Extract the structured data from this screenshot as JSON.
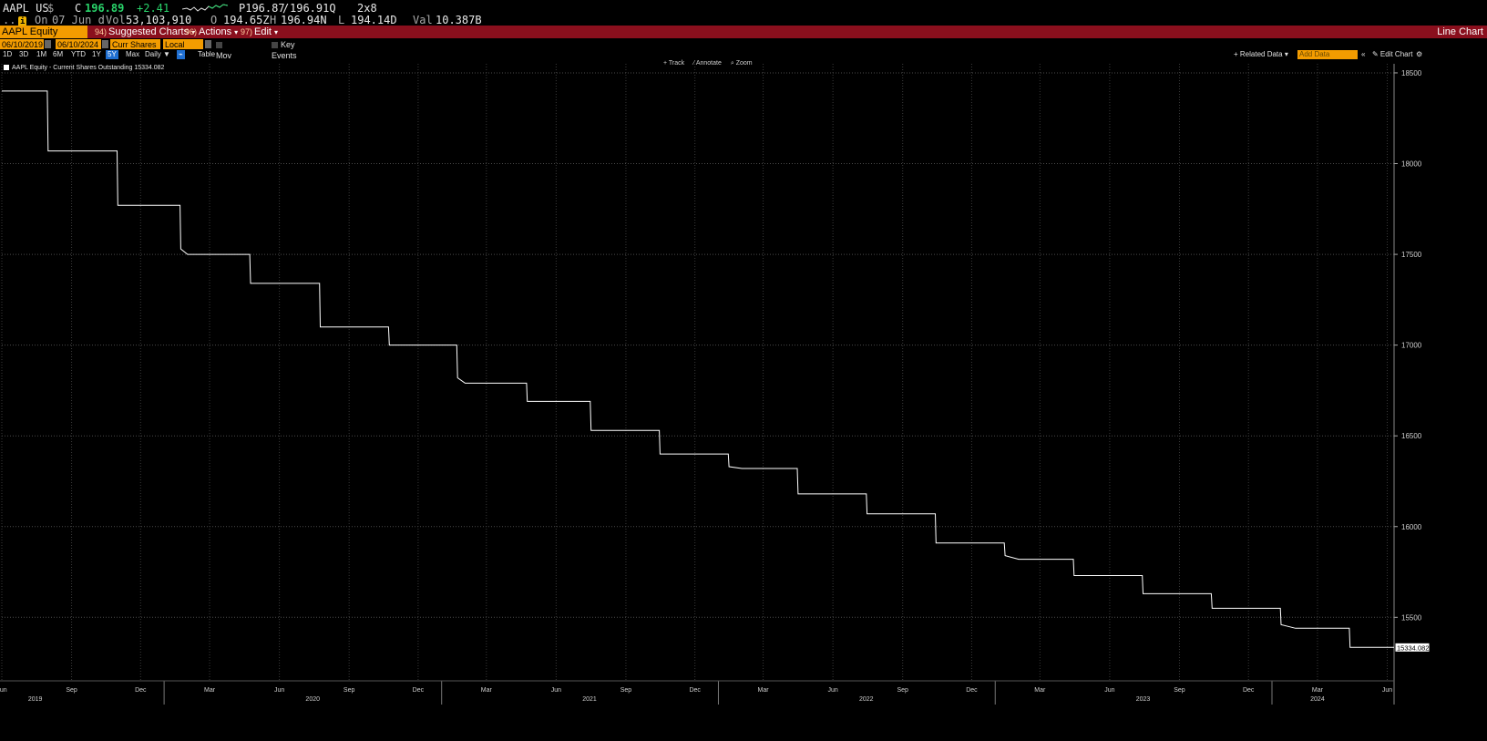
{
  "quote": {
    "ticker": "AAPL US",
    "currency_symbol": "$",
    "close_label": "C",
    "close_value": "196.89",
    "change": "+2.41",
    "pbid": "P196.87",
    "slash": "/",
    "ask": "196.91Q",
    "size": "2x8",
    "icon_label": "On",
    "on_date": "07 Jun d",
    "vol_label": "Vol",
    "vol_value": "53,103,910",
    "open_label": "O",
    "open_value": "194.65Z",
    "high_label": "H",
    "high_value": "196.94N",
    "low_label": "L",
    "low_value": "194.14D",
    "val_label": "Val",
    "val_value": "10.387B"
  },
  "menubar": {
    "security": "AAPL Equity",
    "items": [
      {
        "num": "94)",
        "label": "Suggested Charts"
      },
      {
        "num": "96)",
        "label": "Actions"
      },
      {
        "num": "97)",
        "label": "Edit"
      }
    ],
    "chart_type": "Line Chart"
  },
  "controls": {
    "start_date": "06/10/2019",
    "end_date": "06/10/2024",
    "field": "Curr Shares C",
    "currency": "Local CCY",
    "mov_avgs": "Mov Avgs",
    "key_events": "Key Events"
  },
  "periods": {
    "items": [
      "1D",
      "3D",
      "1M",
      "6M",
      "YTD",
      "1Y",
      "5Y",
      "Max"
    ],
    "active": "5Y",
    "frequency": "Daily ▼",
    "table": "Table",
    "related_data": "+ Related Data ▾",
    "add_data": "Add Data",
    "collapse": "«",
    "edit_chart": "✎ Edit Chart",
    "settings_icon": "gear-icon"
  },
  "toolbar": {
    "track": "+ Track",
    "annotate": "⁄ Annotate",
    "zoom": "⌕ Zoom"
  },
  "legend": {
    "label": "AAPL Equity - Current Shares Outstanding 15334.082"
  },
  "colors": {
    "background": "#000000",
    "menubar": "#8a0f1d",
    "accent_orange": "#f39c00",
    "positive": "#29d36a",
    "line": "#ffffff",
    "active_blue": "#1f6fd1"
  },
  "chart_data": {
    "type": "line",
    "title": "",
    "series": [
      {
        "name": "AAPL Equity - Current Shares Outstanding",
        "points": [
          [
            "2019-06-01",
            18400
          ],
          [
            "2019-07-31",
            18400
          ],
          [
            "2019-08-01",
            18070
          ],
          [
            "2019-10-31",
            18070
          ],
          [
            "2019-11-01",
            17770
          ],
          [
            "2020-01-22",
            17770
          ],
          [
            "2020-01-23",
            17530
          ],
          [
            "2020-02-01",
            17500
          ],
          [
            "2020-04-23",
            17500
          ],
          [
            "2020-04-24",
            17340
          ],
          [
            "2020-07-24",
            17340
          ],
          [
            "2020-07-25",
            17100
          ],
          [
            "2020-10-23",
            17100
          ],
          [
            "2020-10-24",
            17000
          ],
          [
            "2021-01-21",
            17000
          ],
          [
            "2021-01-22",
            16820
          ],
          [
            "2021-02-01",
            16790
          ],
          [
            "2021-04-23",
            16790
          ],
          [
            "2021-04-24",
            16690
          ],
          [
            "2021-07-16",
            16690
          ],
          [
            "2021-07-17",
            16530
          ],
          [
            "2021-10-15",
            16530
          ],
          [
            "2021-10-16",
            16400
          ],
          [
            "2022-01-14",
            16400
          ],
          [
            "2022-01-15",
            16330
          ],
          [
            "2022-02-01",
            16320
          ],
          [
            "2022-04-15",
            16320
          ],
          [
            "2022-04-16",
            16180
          ],
          [
            "2022-07-15",
            16180
          ],
          [
            "2022-07-16",
            16070
          ],
          [
            "2022-10-14",
            16070
          ],
          [
            "2022-10-15",
            15910
          ],
          [
            "2023-01-13",
            15910
          ],
          [
            "2023-01-14",
            15840
          ],
          [
            "2023-02-01",
            15820
          ],
          [
            "2023-04-14",
            15820
          ],
          [
            "2023-04-15",
            15730
          ],
          [
            "2023-07-14",
            15730
          ],
          [
            "2023-07-15",
            15630
          ],
          [
            "2023-10-13",
            15630
          ],
          [
            "2023-10-14",
            15550
          ],
          [
            "2024-01-12",
            15550
          ],
          [
            "2024-01-13",
            15460
          ],
          [
            "2024-02-01",
            15440
          ],
          [
            "2024-04-12",
            15440
          ],
          [
            "2024-04-13",
            15334.082
          ],
          [
            "2024-06-10",
            15334.082
          ]
        ]
      }
    ],
    "last_value_label": "15334.082",
    "y_ticks": [
      15500,
      16000,
      16500,
      17000,
      17500,
      18000,
      18500
    ],
    "ylim": [
      15150,
      18550
    ],
    "xlim": [
      "2019-06-01",
      "2024-06-10"
    ],
    "x_ticks": [
      {
        "date": "2019-06-01",
        "label": "Jun"
      },
      {
        "date": "2019-09-01",
        "label": "Sep"
      },
      {
        "date": "2019-12-01",
        "label": "Dec"
      },
      {
        "date": "2020-03-01",
        "label": "Mar"
      },
      {
        "date": "2020-06-01",
        "label": "Jun"
      },
      {
        "date": "2020-09-01",
        "label": "Sep"
      },
      {
        "date": "2020-12-01",
        "label": "Dec"
      },
      {
        "date": "2021-03-01",
        "label": "Mar"
      },
      {
        "date": "2021-06-01",
        "label": "Jun"
      },
      {
        "date": "2021-09-01",
        "label": "Sep"
      },
      {
        "date": "2021-12-01",
        "label": "Dec"
      },
      {
        "date": "2022-03-01",
        "label": "Mar"
      },
      {
        "date": "2022-06-01",
        "label": "Jun"
      },
      {
        "date": "2022-09-01",
        "label": "Sep"
      },
      {
        "date": "2022-12-01",
        "label": "Dec"
      },
      {
        "date": "2023-03-01",
        "label": "Mar"
      },
      {
        "date": "2023-06-01",
        "label": "Jun"
      },
      {
        "date": "2023-09-01",
        "label": "Sep"
      },
      {
        "date": "2023-12-01",
        "label": "Dec"
      },
      {
        "date": "2024-03-01",
        "label": "Mar"
      },
      {
        "date": "2024-06-01",
        "label": "Jun"
      }
    ],
    "year_labels": [
      {
        "date": "2019-07-15",
        "label": "2019"
      },
      {
        "date": "2020-07-15",
        "label": "2020"
      },
      {
        "date": "2021-07-15",
        "label": "2021"
      },
      {
        "date": "2022-07-15",
        "label": "2022"
      },
      {
        "date": "2023-07-15",
        "label": "2023"
      },
      {
        "date": "2024-03-01",
        "label": "2024"
      }
    ],
    "year_separators": [
      "2020-01-01",
      "2021-01-01",
      "2022-01-01",
      "2023-01-01",
      "2024-01-01"
    ],
    "grid": true
  }
}
